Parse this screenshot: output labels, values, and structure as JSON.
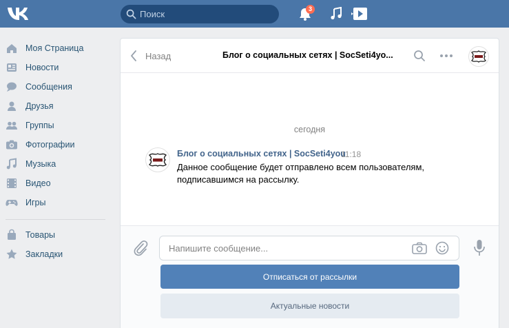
{
  "colors": {
    "header_bg": "#4a76a8",
    "page_bg": "#edeef0",
    "link_text": "#285473",
    "primary_button": "#5181b8",
    "secondary_button": "#e5ebf1",
    "badge": "#ff6d52"
  },
  "header": {
    "logo_icon": "vk-logo-icon",
    "search_placeholder": "Поиск",
    "notifications_count": "3",
    "icons": [
      "bell-icon",
      "music-icon",
      "video-play-icon"
    ]
  },
  "sidebar": {
    "items": [
      {
        "label": "Моя Страница",
        "icon": "home-icon"
      },
      {
        "label": "Новости",
        "icon": "news-icon"
      },
      {
        "label": "Сообщения",
        "icon": "messages-icon"
      },
      {
        "label": "Друзья",
        "icon": "friend-icon"
      },
      {
        "label": "Группы",
        "icon": "groups-icon"
      },
      {
        "label": "Фотографии",
        "icon": "camera-icon"
      },
      {
        "label": "Музыка",
        "icon": "music-icon"
      },
      {
        "label": "Видео",
        "icon": "film-icon"
      },
      {
        "label": "Игры",
        "icon": "gamepad-icon"
      },
      {
        "label": "Товары",
        "icon": "bag-icon"
      },
      {
        "label": "Закладки",
        "icon": "star-icon"
      }
    ]
  },
  "chat": {
    "back_label": "Назад",
    "title": "Блог о социальных сетях | SocSeti4yo...",
    "date_separator": "сегодня",
    "message": {
      "author": "Блог о социальных сетях | SocSeti4you",
      "time": "11:18",
      "text": "Данное сообщение будет отправлено всем пользователям, подписавшимся на рассылку."
    },
    "composer": {
      "placeholder": "Напишите сообщение..."
    },
    "buttons": {
      "unsubscribe": "Отписаться от рассылки",
      "news": "Актуальные новости"
    }
  }
}
